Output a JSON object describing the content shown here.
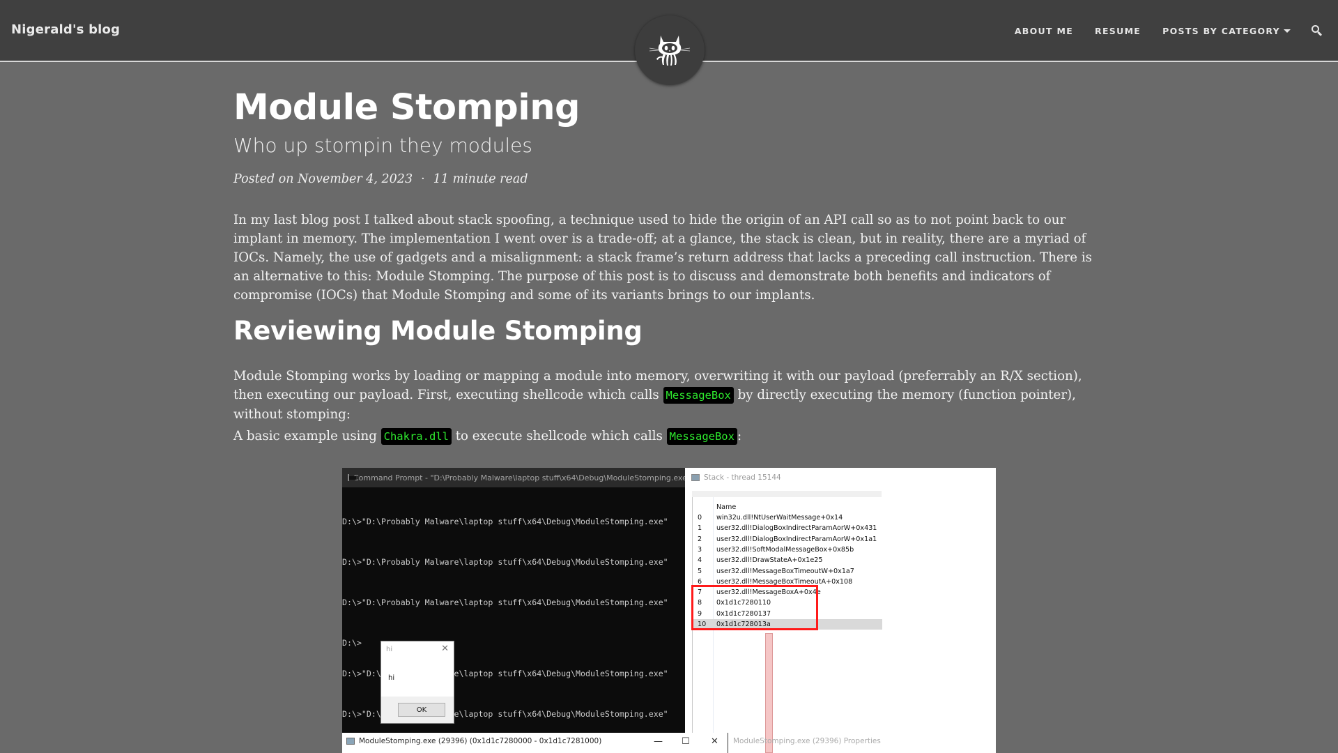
{
  "navbar": {
    "brand": "Nigerald's blog",
    "links": [
      "ABOUT ME",
      "RESUME",
      "POSTS BY CATEGORY"
    ],
    "search_icon": "search-icon",
    "avatar_icon": "octocat-icon"
  },
  "post": {
    "title": "Module Stomping",
    "subtitle": "Who up stompin they modules",
    "posted_on": "Posted on November 4, 2023",
    "meta_separator": "·",
    "read_time": "11 minute read",
    "intro": "In my last blog post I talked about stack spoofing, a technique used to hide the origin of an API call so as to not point back to our implant in memory. The implementation I went over is a trade-off; at a glance, the stack is clean, but in reality, there are a myriad of IOCs. Namely, the use of gadgets and a misalignment: a stack frame’s return address that lacks a preceding call instruction. There is an alternative to this: Module Stomping. The purpose of this post is to discuss and demonstrate both benefits and indicators of compromise (IOCs) that Module Stomping and some of its variants brings to our implants.",
    "section_heading": "Reviewing Module Stomping",
    "p2_before": "Module Stomping works by loading or mapping a module into memory, overwriting it with our payload (preferrably an R/X section), then executing our payload. First, executing shellcode which calls ",
    "p2_code": "MessageBox",
    "p2_after": " by directly executing the memory (function pointer), without stomping:",
    "p3_before": "A basic example using ",
    "p3_code1": "Chakra.dll",
    "p3_middle": " to execute shellcode which calls ",
    "p3_code2": "MessageBox",
    "p3_after": ":"
  },
  "figure": {
    "cmd_title": "Command Prompt - \"D:\\Probably Malware\\laptop stuff\\x64\\Debug\\ModuleStomping.exe\"",
    "cmd_lines": [
      "D:\\>\"D:\\Probably Malware\\laptop stuff\\x64\\Debug\\ModuleStomping.exe\"",
      "D:\\>\"D:\\Probably Malware\\laptop stuff\\x64\\Debug\\ModuleStomping.exe\"",
      "D:\\>\"D:\\Probably Malware\\laptop stuff\\x64\\Debug\\ModuleStomping.exe\"",
      "D:\\>",
      "D:\\>\"D:\\Probably Malware\\laptop stuff\\x64\\Debug\\ModuleStomping.exe\"",
      "D:\\>\"D:\\Probably Malware\\laptop stuff\\x64\\Debug\\ModuleStomping.exe\""
    ],
    "msgbox": {
      "title": "hi",
      "text": "hi",
      "ok": "OK",
      "close": "✕"
    },
    "bottom_window_title": "ModuleStomping.exe (29396) (0x1d1c7280000 - 0x1d1c7281000)",
    "window_controls": {
      "minimize": "—",
      "maximize": "☐",
      "close": "✕"
    },
    "stack_title": "Stack - thread 15144",
    "stack_header": "Name",
    "stack_rows": [
      {
        "idx": "0",
        "name": "win32u.dll!NtUserWaitMessage+0x14"
      },
      {
        "idx": "1",
        "name": "user32.dll!DialogBoxIndirectParamAorW+0x431"
      },
      {
        "idx": "2",
        "name": "user32.dll!DialogBoxIndirectParamAorW+0x1a1"
      },
      {
        "idx": "3",
        "name": "user32.dll!SoftModalMessageBox+0x85b"
      },
      {
        "idx": "4",
        "name": "user32.dll!DrawStateA+0x1e25"
      },
      {
        "idx": "5",
        "name": "user32.dll!MessageBoxTimeoutW+0x1a7"
      },
      {
        "idx": "6",
        "name": "user32.dll!MessageBoxTimeoutA+0x108"
      },
      {
        "idx": "7",
        "name": "user32.dll!MessageBoxA+0x4e"
      },
      {
        "idx": "8",
        "name": "0x1d1c7280110"
      },
      {
        "idx": "9",
        "name": "0x1d1c7280137"
      },
      {
        "idx": "10",
        "name": "0x1d1c728013a"
      }
    ],
    "selected_row": 10,
    "properties_title": "ModuleStomping.exe (29396) Properties",
    "highlight_color": "#ff1a1a"
  },
  "colors": {
    "navbar_bg": "#404040",
    "page_bg": "#6a6a6a",
    "code_bg": "#000000",
    "code_fg": "#2ee82e"
  }
}
